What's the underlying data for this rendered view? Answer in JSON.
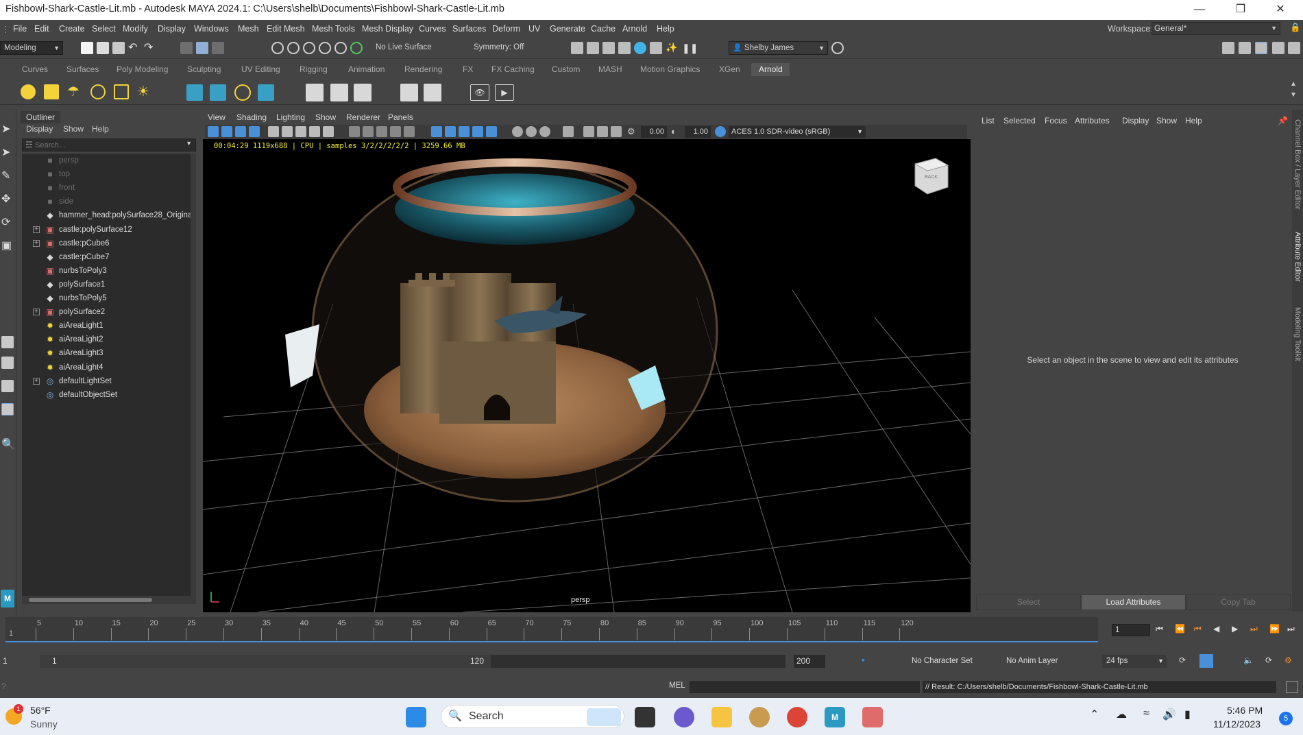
{
  "window": {
    "title": "Fishbowl-Shark-Castle-Lit.mb - Autodesk MAYA 2024.1: C:\\Users\\shelb\\Documents\\Fishbowl-Shark-Castle-Lit.mb"
  },
  "menubar": {
    "items": [
      "File",
      "Edit",
      "Create",
      "Select",
      "Modify",
      "Display",
      "Windows",
      "Mesh",
      "Edit Mesh",
      "Mesh Tools",
      "Mesh Display",
      "Curves",
      "Surfaces",
      "Deform",
      "UV",
      "Generate",
      "Cache",
      "Arnold",
      "Help"
    ],
    "workspace_label": "Workspace:",
    "workspace_value": "General*"
  },
  "statusline": {
    "mode": "Modeling",
    "live_surface": "No Live Surface",
    "symmetry": "Symmetry: Off",
    "user": "Shelby James"
  },
  "shelf": {
    "tabs": [
      "Curves",
      "Surfaces",
      "Poly Modeling",
      "Sculpting",
      "UV Editing",
      "Rigging",
      "Animation",
      "Rendering",
      "FX",
      "FX Caching",
      "Custom",
      "MASH",
      "Motion Graphics",
      "XGen",
      "Arnold"
    ],
    "active_tab": "Arnold"
  },
  "outliner": {
    "title": "Outliner",
    "menu": [
      "Display",
      "Show",
      "Help"
    ],
    "search_placeholder": "Search...",
    "items": [
      {
        "label": "persp",
        "icon": "camera-icon",
        "dim": true,
        "expandable": false
      },
      {
        "label": "top",
        "icon": "camera-icon",
        "dim": true,
        "expandable": false
      },
      {
        "label": "front",
        "icon": "camera-icon",
        "dim": true,
        "expandable": false
      },
      {
        "label": "side",
        "icon": "camera-icon",
        "dim": true,
        "expandable": false
      },
      {
        "label": "hammer_head:polySurface28_Origina",
        "icon": "mesh-icon",
        "dim": false,
        "expandable": false
      },
      {
        "label": "castle:polySurface12",
        "icon": "group-icon",
        "dim": false,
        "expandable": true
      },
      {
        "label": "castle:pCube6",
        "icon": "group-icon",
        "dim": false,
        "expandable": true
      },
      {
        "label": "castle:pCube7",
        "icon": "mesh-icon",
        "dim": false,
        "expandable": false
      },
      {
        "label": "nurbsToPoly3",
        "icon": "group-icon",
        "dim": false,
        "expandable": false
      },
      {
        "label": "polySurface1",
        "icon": "mesh-icon",
        "dim": false,
        "expandable": false
      },
      {
        "label": "nurbsToPoly5",
        "icon": "mesh-icon",
        "dim": false,
        "expandable": false
      },
      {
        "label": "polySurface2",
        "icon": "group-icon",
        "dim": false,
        "expandable": true
      },
      {
        "label": "aiAreaLight1",
        "icon": "light-icon",
        "dim": false,
        "expandable": false
      },
      {
        "label": "aiAreaLight2",
        "icon": "light-icon",
        "dim": false,
        "expandable": false
      },
      {
        "label": "aiAreaLight3",
        "icon": "light-icon",
        "dim": false,
        "expandable": false
      },
      {
        "label": "aiAreaLight4",
        "icon": "light-icon",
        "dim": false,
        "expandable": false
      },
      {
        "label": "defaultLightSet",
        "icon": "set-icon",
        "dim": false,
        "expandable": true
      },
      {
        "label": "defaultObjectSet",
        "icon": "set-icon",
        "dim": false,
        "expandable": false
      }
    ]
  },
  "viewport": {
    "menu": [
      "View",
      "Shading",
      "Lighting",
      "Show",
      "Renderer",
      "Panels"
    ],
    "exposure": "0.00",
    "gamma": "1.00",
    "color_space": "ACES 1.0 SDR-video (sRGB)",
    "hud": "00:04:29 1119x688 | CPU | samples 3/2/2/2/2/2 | 3259.66 MB",
    "camera": "persp",
    "viewcube_label": "BACK"
  },
  "attribute_editor": {
    "menu": [
      "List",
      "Selected",
      "Focus",
      "Attributes",
      "Display",
      "Show",
      "Help"
    ],
    "message": "Select an object in the scene to view and edit its attributes",
    "buttons": [
      "Select",
      "Load Attributes",
      "Copy Tab"
    ],
    "side_tabs": [
      "Channel Box / Layer Editor",
      "Attribute Editor",
      "Modeling Toolkit"
    ]
  },
  "timeslider": {
    "ticks": [
      "5",
      "10",
      "15",
      "20",
      "25",
      "30",
      "35",
      "40",
      "45",
      "50",
      "55",
      "60",
      "65",
      "70",
      "75",
      "80",
      "85",
      "90",
      "95",
      "100",
      "105",
      "110",
      "115",
      "120"
    ],
    "start_label": "1",
    "current_frame": "1"
  },
  "rangeslider": {
    "start": "1",
    "range_start": "1",
    "range_end": "120",
    "end": "200",
    "character_set": "No Character Set",
    "anim_layer": "No Anim Layer",
    "fps": "24 fps"
  },
  "commandline": {
    "type": "MEL",
    "result": "// Result: C:/Users/shelb/Documents/Fishbowl-Shark-Castle-Lit.mb"
  },
  "taskbar": {
    "weather_temp": "56°F",
    "weather_cond": "Sunny",
    "weather_badge": "1",
    "search": "Search",
    "time": "5:46 PM",
    "date": "11/12/2023",
    "notifications": "5"
  }
}
